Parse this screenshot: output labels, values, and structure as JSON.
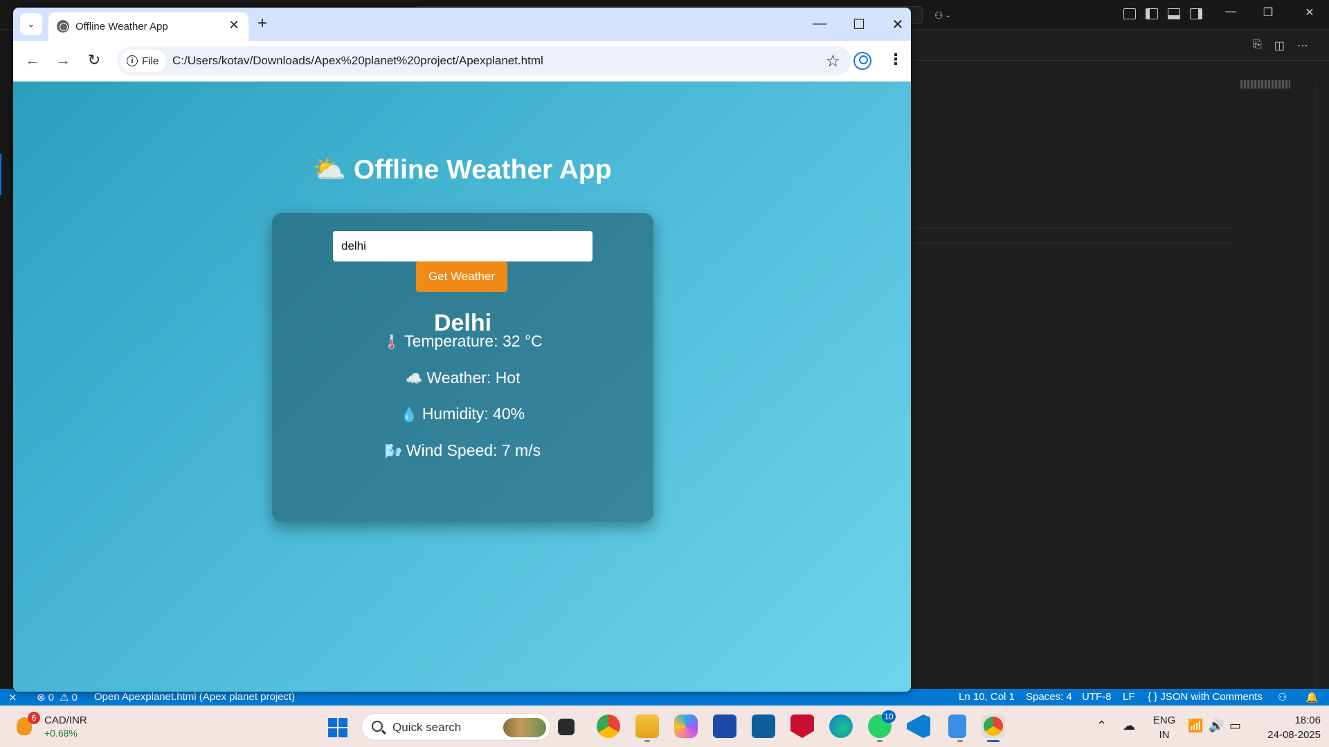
{
  "browser": {
    "tab_title": "Offline Weather App",
    "new_tab_label": "+",
    "site_chip_label": "File",
    "url": "C:/Users/kotav/Downloads/Apex%20planet%20project/Apexplanet.html"
  },
  "page": {
    "title_icon": "⛅",
    "title": "Offline Weather App",
    "city_input_value": "delhi",
    "button_label": "Get Weather",
    "city_name": "Delhi",
    "rows": [
      {
        "icon": "🌡️",
        "text": "Temperature: 32 °C"
      },
      {
        "icon": "☁️",
        "text": "Weather: Hot"
      },
      {
        "icon": "💧",
        "text": "Humidity: 40%"
      },
      {
        "icon": "🌬️",
        "text": "Wind Speed: 7 m/s"
      }
    ]
  },
  "statusbar": {
    "errors": "⊗ 0",
    "warnings": "⚠ 0",
    "open_file": "Open Apexplanet.html (Apex planet project)",
    "position": "Ln 10, Col 1",
    "spaces": "Spaces: 4",
    "encoding": "UTF-8",
    "eol": "LF",
    "language": "{ } JSON with Comments"
  },
  "taskbar": {
    "ticker_badge": "6",
    "ticker_name": "CAD/INR",
    "ticker_change": "+0.68%",
    "search_label": "Quick search",
    "whatsapp_badge": "10",
    "lang_1": "ENG",
    "lang_2": "IN",
    "time": "18:06",
    "date": "24-08-2025"
  },
  "colors": {
    "accent_button": "#f08a16",
    "statusbar": "#0078d4",
    "gradient_start": "#2aa0bd",
    "gradient_end": "#6dd5ec"
  }
}
